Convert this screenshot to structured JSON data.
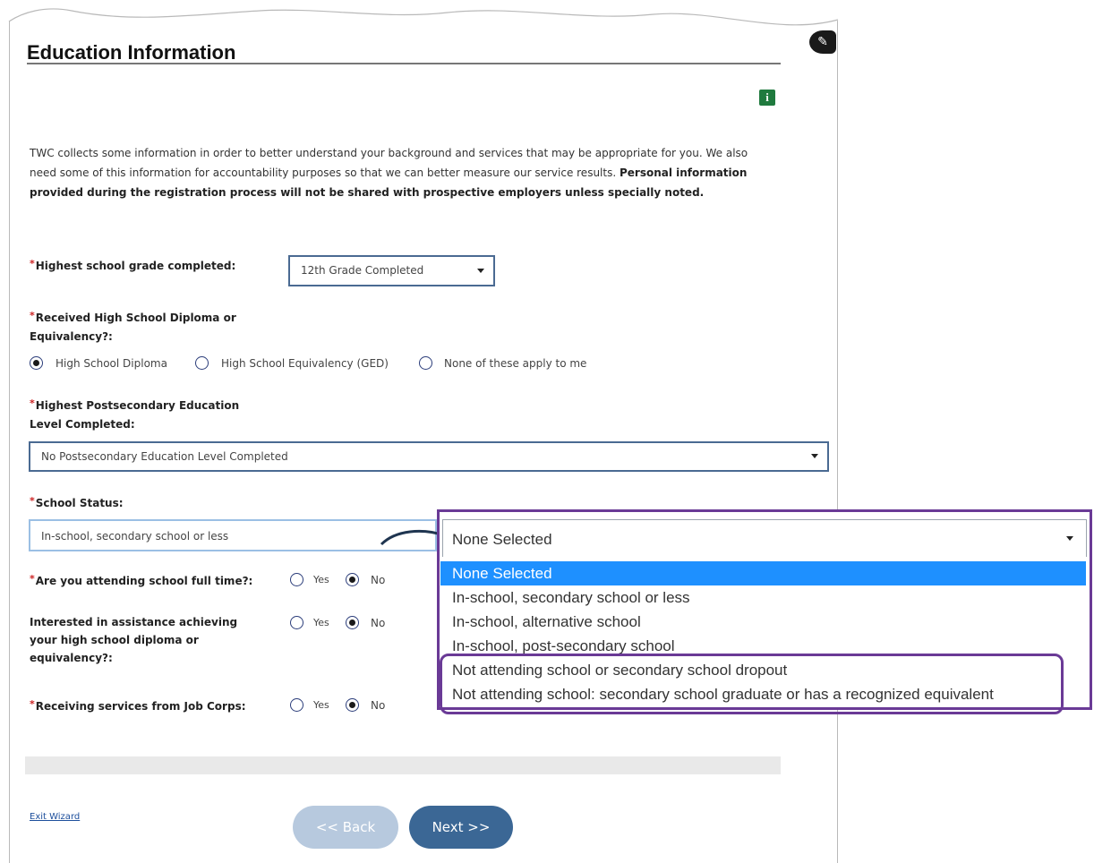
{
  "page": {
    "title": "Education Information",
    "intro_text": "TWC collects some information in order to better understand your background and services that may be appropriate for you. We also need some of this information for accountability purposes so that we can better measure our service results.",
    "intro_bold": "Personal information provided during the registration process will not be shared with prospective employers unless specially noted."
  },
  "icons": {
    "info": "i",
    "edit": "✎"
  },
  "form": {
    "required_marker": "*",
    "highest_grade": {
      "label": "Highest school grade completed:",
      "value": "12th Grade Completed"
    },
    "diploma": {
      "label_line1": "Received High School Diploma or",
      "label_line2": "Equivalency?:",
      "options": [
        "High School Diploma",
        "High School Equivalency (GED)",
        "None of these apply to me"
      ],
      "selected": "High School Diploma"
    },
    "postsecondary": {
      "label_line1": "Highest Postsecondary Education",
      "label_line2": "Level Completed:",
      "value": "No Postsecondary Education Level Completed"
    },
    "school_status": {
      "label": "School Status:",
      "value": "In-school, secondary school or less"
    },
    "full_time": {
      "label": "Are you attending school full time?:",
      "yes": "Yes",
      "no": "No",
      "selected": "No"
    },
    "diploma_assist": {
      "label_line1": "Interested in assistance achieving",
      "label_line2": "your high school diploma or",
      "label_line3": "equivalency?:",
      "yes": "Yes",
      "no": "No",
      "selected": "No"
    },
    "job_corps": {
      "label": "Receiving services from Job Corps:",
      "yes": "Yes",
      "no": "No",
      "selected": "No"
    }
  },
  "dropdown": {
    "current": "None Selected",
    "options": [
      "None Selected",
      "In-school, secondary school or less",
      "In-school, alternative school",
      "In-school, post-secondary school",
      "Not attending school or secondary school dropout",
      "Not attending school: secondary school graduate or has a recognized equivalent"
    ],
    "highlighted": "None Selected"
  },
  "footer": {
    "exit_link": "Exit Wizard",
    "back_button": "<< Back",
    "next_button": "Next >>"
  },
  "colors": {
    "accent_purple": "#6a3a96",
    "next_button": "#3b6795",
    "back_button_disabled": "#b7c9de",
    "selected_option": "#1e90ff",
    "info_icon": "#1f7a3e"
  }
}
